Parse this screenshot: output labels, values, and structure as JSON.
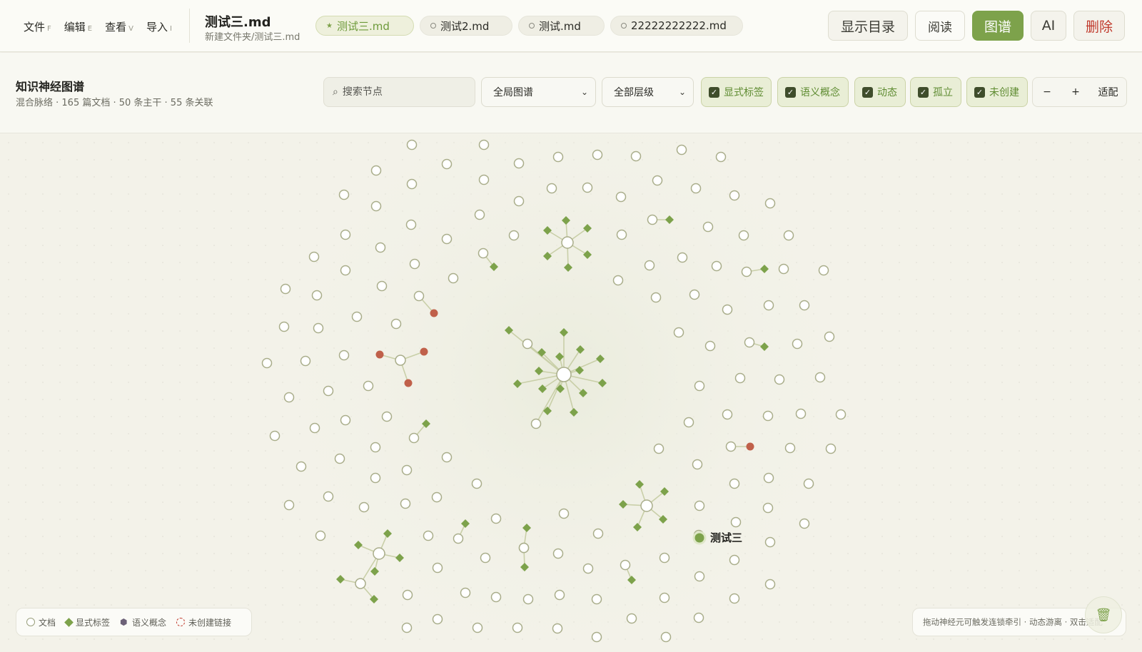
{
  "menu": [
    {
      "label": "文件",
      "hotkey": "F"
    },
    {
      "label": "编辑",
      "hotkey": "E"
    },
    {
      "label": "查看",
      "hotkey": "V"
    },
    {
      "label": "导入",
      "hotkey": "I"
    }
  ],
  "doc": {
    "title": "测试三.md",
    "path": "新建文件夹/测试三.md"
  },
  "tabs": [
    {
      "label": "测试三.md",
      "active": true
    },
    {
      "label": "测试2.md",
      "active": false
    },
    {
      "label": "测试.md",
      "active": false
    },
    {
      "label": "22222222222.md",
      "active": false
    }
  ],
  "actions": {
    "toc": "显示目录",
    "read": "阅读",
    "graph": "图谱",
    "ai": "AI",
    "delete": "删除"
  },
  "graph": {
    "title": "知识神经图谱",
    "stats": "混合脉络 · 165 篇文档 · 50 条主干 · 55 条关联"
  },
  "search": {
    "placeholder": "搜索节点",
    "value": ""
  },
  "scope": {
    "selected": "全局图谱"
  },
  "level": {
    "selected": "全部层级"
  },
  "filters": [
    {
      "label": "显式标签",
      "checked": true
    },
    {
      "label": "语义概念",
      "checked": true
    },
    {
      "label": "动态",
      "checked": true
    },
    {
      "label": "孤立",
      "checked": true
    },
    {
      "label": "未创建",
      "checked": true
    }
  ],
  "zoom": {
    "out": "−",
    "in": "+",
    "fit": "适配"
  },
  "legend": {
    "doc": "文档",
    "tag": "显式标签",
    "concept": "语义概念",
    "uncreated": "未创建链接"
  },
  "hint": "拖动神经元可触发连锁牵引 · 动态游离 · 双击适配",
  "highlight": {
    "label": "测试三"
  },
  "colors": {
    "accent": "#7da24b",
    "danger": "#c0392b",
    "node_stroke": "#a9ad8a",
    "edge": "#c9cfa8"
  }
}
